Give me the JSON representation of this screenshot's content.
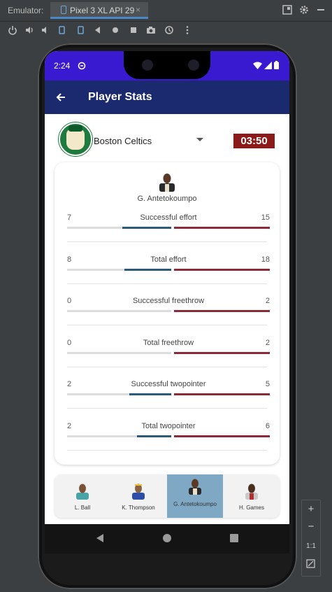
{
  "emulator": {
    "label": "Emulator:",
    "tab_title": "Pixel 3 XL API 29",
    "tab_close": "×",
    "zoom_in": "+",
    "zoom_out": "−",
    "ratio": "1:1"
  },
  "status_bar": {
    "time": "2:24"
  },
  "app_bar": {
    "title": "Player Stats"
  },
  "team": {
    "name": "Boston Celtics",
    "timer": "03:50"
  },
  "player": {
    "name": "G. Antetokoumpo"
  },
  "stats": [
    {
      "label": "Successful effort",
      "left": "7",
      "right": "15",
      "left_fill": 0.47,
      "right_fill": 1.0
    },
    {
      "label": "Total effort",
      "left": "8",
      "right": "18",
      "left_fill": 0.45,
      "right_fill": 1.0
    },
    {
      "label": "Successful freethrow",
      "left": "0",
      "right": "2",
      "left_fill": 0.0,
      "right_fill": 1.0
    },
    {
      "label": "Total freethrow",
      "left": "0",
      "right": "2",
      "left_fill": 0.0,
      "right_fill": 1.0
    },
    {
      "label": "Successful twopointer",
      "left": "2",
      "right": "5",
      "left_fill": 0.4,
      "right_fill": 1.0
    },
    {
      "label": "Total twopointer",
      "left": "2",
      "right": "6",
      "left_fill": 0.33,
      "right_fill": 1.0
    }
  ],
  "roster": [
    {
      "name": "L. Ball",
      "selected": false
    },
    {
      "name": "K. Thompson",
      "selected": false
    },
    {
      "name": "G. Antetokoumpo",
      "selected": true
    },
    {
      "name": "H. Games",
      "selected": false
    }
  ],
  "colors": {
    "status_bar": "#3a1ad1",
    "app_bar": "#1b2a6e",
    "timer_bg": "#8b1a1a",
    "left_bar": "#2c5a7a",
    "right_bar": "#8b2a3a",
    "selected_player": "#7fa8c4"
  }
}
